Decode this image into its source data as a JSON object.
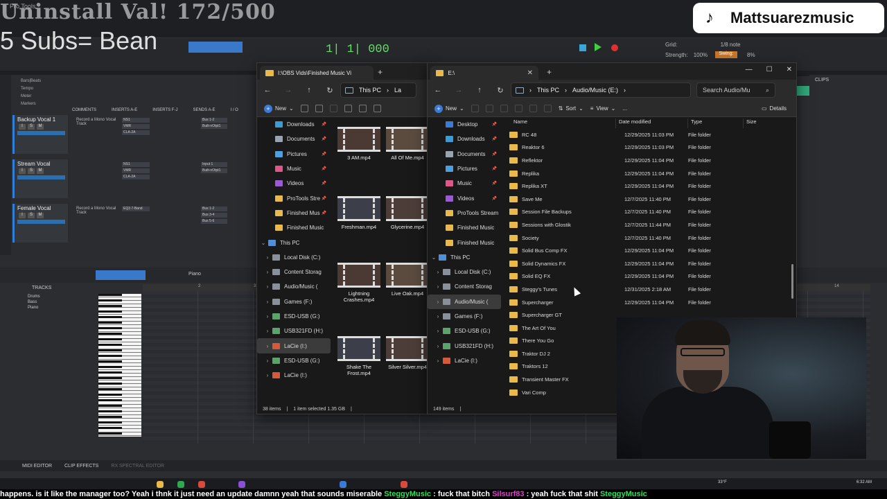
{
  "overlay": {
    "uninstall_text": "Uninstall Val! 172/500",
    "subs_text": "5 Subs= Bean",
    "tiktok_handle": "Mattsuarezmusic"
  },
  "protools": {
    "title": "Pro Tools",
    "counter": "1| 1| 000",
    "grid_label": "Grid:",
    "grid_value": "1/8 note",
    "strength_label": "Strength:",
    "strength_value": "100%",
    "swing_label": "Swing:",
    "swing_value": "8%",
    "bars_beats": "Bars|Beats",
    "tempo": "Tempo",
    "meter": "Meter",
    "markers": "Markers",
    "mix_headers": [
      "COMMENTS",
      "INSERTS A-E",
      "INSERTS F-J",
      "SENDS A-E",
      "I / O"
    ],
    "tracks": [
      {
        "name": "Backup Vocal 1",
        "comment": "Record a Mono Vocal Track",
        "inserts": [
          "NS1",
          "VMR",
          "CLA-2A"
        ],
        "sends": [
          "Bus 1-2",
          "Built-nOtpt1"
        ]
      },
      {
        "name": "Stream Vocal",
        "comment": "",
        "inserts": [
          "NS1",
          "VMR",
          "CLA-2A"
        ],
        "sends": [
          "Input 1",
          "Built-nOtpt1"
        ]
      },
      {
        "name": "Female Vocal",
        "comment": "Record a Mono Vocal Track",
        "inserts": [
          "EQ3 7-Band"
        ],
        "sends": [
          "Bus 1-2",
          "Bus 3-4",
          "Bus 5-6"
        ]
      }
    ],
    "midi_tracks_label": "TRACKS",
    "midi_tracks": [
      "Drums",
      "Bass",
      "Piano"
    ],
    "midi_instrument": "Piano",
    "bottom_tabs": [
      "MIDI EDITOR",
      "CLIP EFFECTS",
      "RX SPECTRAL EDITOR"
    ],
    "clips_label": "CLIPS",
    "ruler_marks": [
      "2",
      "3",
      "14"
    ]
  },
  "explorer_left": {
    "tab_title": "I:\\OBS Vids\\Finished Music Vi",
    "address": [
      "This PC",
      "La"
    ],
    "command_new": "New",
    "nav_items": [
      {
        "label": "Downloads",
        "icon": "download-icon",
        "pinned": true
      },
      {
        "label": "Documents",
        "icon": "documents-icon",
        "pinned": true
      },
      {
        "label": "Pictures",
        "icon": "pictures-icon",
        "pinned": true
      },
      {
        "label": "Music",
        "icon": "music-icon",
        "pinned": true
      },
      {
        "label": "Videos",
        "icon": "videos-icon",
        "pinned": true
      },
      {
        "label": "ProTools Stre",
        "icon": "folder-icon",
        "pinned": true
      },
      {
        "label": "Finished Mus",
        "icon": "folder-icon",
        "pinned": true
      },
      {
        "label": "Finished Music",
        "icon": "folder-icon",
        "pinned": false
      },
      {
        "label": "This PC",
        "icon": "pc-icon",
        "pinned": false,
        "expanded": true
      },
      {
        "label": "Local Disk (C:)",
        "icon": "drive-icon",
        "pinned": false
      },
      {
        "label": "Content Storag",
        "icon": "drive-icon",
        "pinned": false
      },
      {
        "label": "Audio/Music (",
        "icon": "drive-icon",
        "pinned": false
      },
      {
        "label": "Games (F:)",
        "icon": "drive-icon",
        "pinned": false
      },
      {
        "label": "ESD-USB (G:)",
        "icon": "usb-icon",
        "pinned": false
      },
      {
        "label": "USB321FD (H:)",
        "icon": "usb-icon",
        "pinned": false
      },
      {
        "label": "LaCie (I:)",
        "icon": "lacie-icon",
        "pinned": false,
        "selected": true
      },
      {
        "label": "ESD-USB (G:)",
        "icon": "usb-icon",
        "pinned": false
      },
      {
        "label": "LaCie (I:)",
        "icon": "lacie-icon",
        "pinned": false
      }
    ],
    "thumbnails": [
      {
        "label": "3 AM.mp4"
      },
      {
        "label": "All Of Me.mp4"
      },
      {
        "label": "Freshman.mp4"
      },
      {
        "label": "Glycerine.mp4"
      },
      {
        "label": "Lightning Crashes.mp4"
      },
      {
        "label": "Live Oak.mp4"
      },
      {
        "label": "Shake The Frost.mp4"
      },
      {
        "label": "Silver Silver.mp4"
      }
    ],
    "status": {
      "count": "38 items",
      "selection": "1 item selected  1.35 GB"
    }
  },
  "explorer_right": {
    "tab_title": "E:\\",
    "address": [
      "This PC",
      "Audio/Music (E:)"
    ],
    "search_placeholder": "Search Audio/Mu",
    "commands": {
      "new": "New",
      "sort": "Sort",
      "view": "View",
      "more": "...",
      "details": "Details"
    },
    "nav_items": [
      {
        "label": "Desktop",
        "icon": "desktop-icon",
        "pinned": true
      },
      {
        "label": "Downloads",
        "icon": "download-icon",
        "pinned": true
      },
      {
        "label": "Documents",
        "icon": "documents-icon",
        "pinned": true
      },
      {
        "label": "Pictures",
        "icon": "pictures-icon",
        "pinned": true
      },
      {
        "label": "Music",
        "icon": "music-icon",
        "pinned": true
      },
      {
        "label": "Videos",
        "icon": "videos-icon",
        "pinned": true
      },
      {
        "label": "ProTools Stream",
        "icon": "folder-icon",
        "pinned": false
      },
      {
        "label": "Finished Music",
        "icon": "folder-icon",
        "pinned": false
      },
      {
        "label": "Finished Music",
        "icon": "folder-icon",
        "pinned": false
      },
      {
        "label": "This PC",
        "icon": "pc-icon",
        "pinned": false,
        "expanded": true
      },
      {
        "label": "Local Disk (C:)",
        "icon": "drive-icon",
        "pinned": false
      },
      {
        "label": "Content Storag",
        "icon": "drive-icon",
        "pinned": false
      },
      {
        "label": "Audio/Music (",
        "icon": "drive-icon",
        "pinned": false,
        "selected": true
      },
      {
        "label": "Games (F:)",
        "icon": "drive-icon",
        "pinned": false
      },
      {
        "label": "ESD-USB (G:)",
        "icon": "usb-icon",
        "pinned": false
      },
      {
        "label": "USB321FD (H:)",
        "icon": "usb-icon",
        "pinned": false
      },
      {
        "label": "LaCie (I:)",
        "icon": "lacie-icon",
        "pinned": false
      }
    ],
    "columns": [
      "Name",
      "Date modified",
      "Type",
      "Size"
    ],
    "files": [
      {
        "name": "RC 48",
        "date": "12/29/2025 11:03 PM",
        "type": "File folder"
      },
      {
        "name": "Reaktor 6",
        "date": "12/29/2025 11:03 PM",
        "type": "File folder"
      },
      {
        "name": "Reflektor",
        "date": "12/29/2025 11:04 PM",
        "type": "File folder"
      },
      {
        "name": "Replika",
        "date": "12/29/2025 11:04 PM",
        "type": "File folder"
      },
      {
        "name": "Replika XT",
        "date": "12/29/2025 11:04 PM",
        "type": "File folder"
      },
      {
        "name": "Save Me",
        "date": "12/7/2025 11:40 PM",
        "type": "File folder"
      },
      {
        "name": "Session File Backups",
        "date": "12/7/2025 11:40 PM",
        "type": "File folder"
      },
      {
        "name": "Sessions with Glostik",
        "date": "12/7/2025 11:44 PM",
        "type": "File folder"
      },
      {
        "name": "Society",
        "date": "12/7/2025 11:40 PM",
        "type": "File folder"
      },
      {
        "name": "Solid Bus Comp FX",
        "date": "12/29/2025 11:04 PM",
        "type": "File folder"
      },
      {
        "name": "Solid Dynamics FX",
        "date": "12/29/2025 11:04 PM",
        "type": "File folder"
      },
      {
        "name": "Solid EQ FX",
        "date": "12/29/2025 11:04 PM",
        "type": "File folder"
      },
      {
        "name": "Steggy's Tunes",
        "date": "12/31/2025 2:18 AM",
        "type": "File folder"
      },
      {
        "name": "Supercharger",
        "date": "12/29/2025 11:04 PM",
        "type": "File folder"
      },
      {
        "name": "Supercharger GT",
        "date": "",
        "type": ""
      },
      {
        "name": "The Art Of You",
        "date": "",
        "type": ""
      },
      {
        "name": "There You Go",
        "date": "",
        "type": ""
      },
      {
        "name": "Traktor DJ 2",
        "date": "",
        "type": ""
      },
      {
        "name": "Traktors 12",
        "date": "",
        "type": ""
      },
      {
        "name": "Transient Master FX",
        "date": "",
        "type": ""
      },
      {
        "name": "Vari Comp",
        "date": "",
        "type": ""
      }
    ],
    "status": {
      "count": "149 items"
    }
  },
  "taskbar": {
    "weather": "33°F",
    "time": "6:32 AM"
  },
  "chat_ticker": [
    {
      "text": "happens.  is it like the manager too?  Yeah i thnk it just need an update  damnn  yeah that sounds miserable  ",
      "color": "#ffffff"
    },
    {
      "text": "SteggyMusic",
      "color": "#2ee05a"
    },
    {
      "text": " :  fuck that bitch  ",
      "color": "#ffffff"
    },
    {
      "text": "Silsurf83",
      "color": "#e03fd0"
    },
    {
      "text": " :  yeah fuck that shit  ",
      "color": "#ffffff"
    },
    {
      "text": "SteggyMusic",
      "color": "#2ee05a"
    }
  ]
}
